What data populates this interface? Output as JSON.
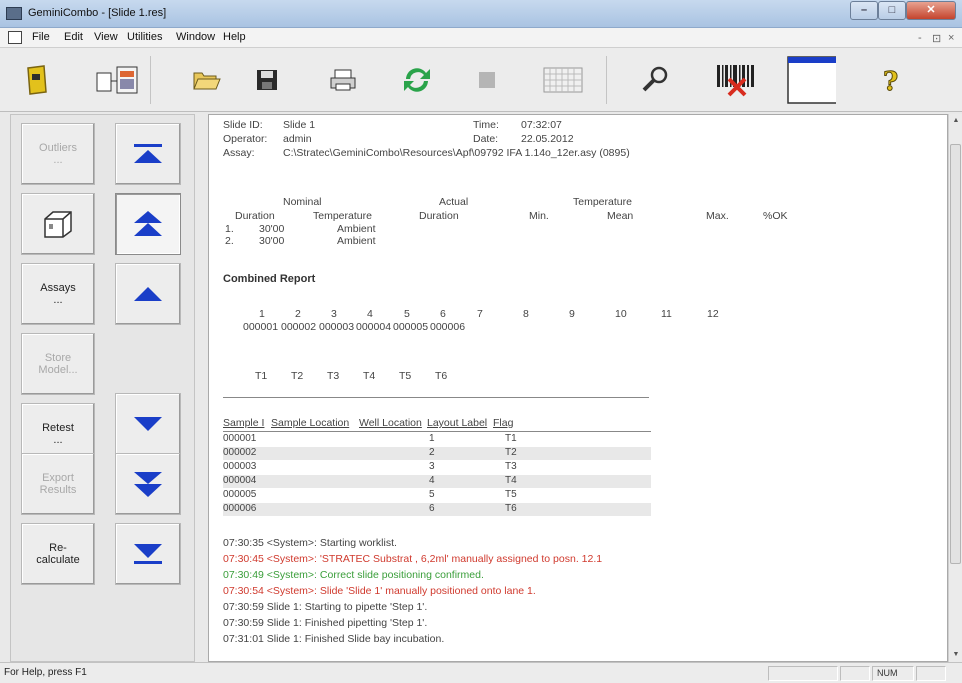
{
  "window": {
    "title": "GeminiCombo - [Slide 1.res]",
    "controls": {
      "minimize": "–",
      "maximize": "□",
      "close": "✕"
    }
  },
  "menu": {
    "items": [
      "File",
      "Edit",
      "View",
      "Utilities",
      "Window",
      "Help"
    ],
    "mdi_controls": [
      "-",
      "⊡",
      "×"
    ]
  },
  "toolbar": {
    "buttons": [
      "open-icon",
      "new-layout-icon",
      "folder-open-icon",
      "save-icon",
      "print-icon",
      "refresh-icon",
      "stop-icon",
      "grid-icon",
      "wrench-icon",
      "barcode-icon",
      "window-icon",
      "help-icon"
    ],
    "accent_colors": {
      "gold": "#e2c11c",
      "green": "#2aa34a",
      "blue": "#1a3ec8",
      "red": "#d82c1f"
    }
  },
  "left_panel": {
    "buttons": [
      {
        "label": "Outliers",
        "sub": "...",
        "enabled": false
      },
      {
        "label": "",
        "sub": "",
        "enabled": true
      },
      {
        "label": "Assays",
        "sub": "...",
        "enabled": true
      },
      {
        "label": "Store",
        "sub": "Model...",
        "enabled": false
      },
      {
        "label": "Retest",
        "sub": "...",
        "enabled": true
      },
      {
        "label": "Export",
        "sub": "Results",
        "enabled": false
      },
      {
        "label": "Re-",
        "sub": "calculate",
        "enabled": true
      }
    ],
    "arrow_buttons": [
      "top",
      "page-up",
      "up",
      "down",
      "page-down",
      "bottom"
    ]
  },
  "report": {
    "header": {
      "slide_id_label": "Slide ID:",
      "slide_id": "Slide 1",
      "time_label": "Time:",
      "time": "07:32:07",
      "operator_label": "Operator:",
      "operator": "admin",
      "date_label": "Date:",
      "date": "22.05.2012",
      "assay_label": "Assay:",
      "assay": "C:\\Stratec\\GeminiCombo\\Resources\\Apf\\09792 IFA  1.14o_12er.asy (0895)"
    },
    "steps": {
      "nominal": "Nominal",
      "actual": "Actual",
      "temperature": "Temperature",
      "duration": "Duration",
      "temp_col": "Temperature",
      "actual_duration": "Duration",
      "min": "Min.",
      "mean": "Mean",
      "max": "Max.",
      "ok": "%OK",
      "rows": [
        {
          "n": "1.",
          "duration": "30'00",
          "temperature": "Ambient"
        },
        {
          "n": "2.",
          "duration": "30'00",
          "temperature": "Ambient"
        }
      ]
    },
    "combined_title": "Combined Report",
    "well_numbers": [
      "1",
      "2",
      "3",
      "4",
      "5",
      "6",
      "7",
      "8",
      "9",
      "10",
      "11",
      "12"
    ],
    "well_samples": [
      "000001",
      "000002",
      "000003",
      "000004",
      "000005",
      "000006"
    ],
    "well_labels": [
      "T1",
      "T2",
      "T3",
      "T4",
      "T5",
      "T6"
    ],
    "sample_table": {
      "headers": [
        "Sample I",
        "Sample Location",
        "Well Location",
        "Layout Label",
        "Flag"
      ],
      "rows": [
        [
          "000001",
          "",
          "1",
          "T1",
          ""
        ],
        [
          "000002",
          "",
          "2",
          "T2",
          ""
        ],
        [
          "000003",
          "",
          "3",
          "T3",
          ""
        ],
        [
          "000004",
          "",
          "4",
          "T4",
          ""
        ],
        [
          "000005",
          "",
          "5",
          "T5",
          ""
        ],
        [
          "000006",
          "",
          "6",
          "T6",
          ""
        ]
      ]
    },
    "log": [
      {
        "text": "07:30:35 <System>: Starting worklist.",
        "color": "#444444"
      },
      {
        "text": "07:30:45 <System>: 'STRATEC Substrat , 6,2ml' manually assigned to posn. 12.1",
        "color": "#d03a2e"
      },
      {
        "text": "07:30:49 <System>: Correct slide positioning confirmed.",
        "color": "#3a9e3a"
      },
      {
        "text": "07:30:54 <System>: Slide 'Slide 1' manually positioned onto lane 1.",
        "color": "#d03a2e"
      },
      {
        "text": "07:30:59 Slide 1: Starting to pipette 'Step 1'.",
        "color": "#444444"
      },
      {
        "text": "07:30:59 Slide 1: Finished pipetting 'Step 1'.",
        "color": "#444444"
      },
      {
        "text": "07:31:01 Slide 1: Finished Slide bay incubation.",
        "color": "#444444"
      }
    ]
  },
  "statusbar": {
    "help": "For Help, press F1",
    "num": "NUM"
  }
}
